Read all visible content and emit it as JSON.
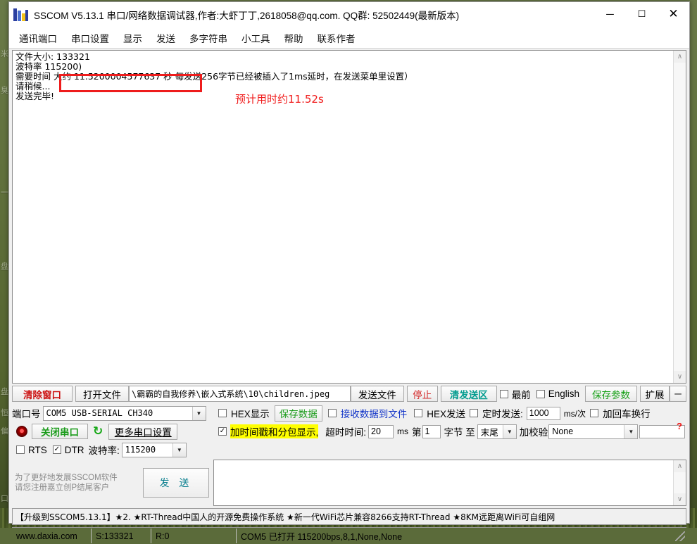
{
  "window": {
    "title": "SSCOM V5.13.1 串口/网络数据调试器,作者:大虾丁丁,2618058@qq.com. QQ群: 52502449(最新版本)",
    "app_icon": "sscom-icon",
    "minimize": "─",
    "maximize": "☐",
    "close": "✕"
  },
  "menu": {
    "items": [
      {
        "label": "通讯端口"
      },
      {
        "label": "串口设置"
      },
      {
        "label": "显示"
      },
      {
        "label": "发送"
      },
      {
        "label": "多字符串"
      },
      {
        "label": "小工具"
      },
      {
        "label": "帮助"
      },
      {
        "label": "联系作者"
      }
    ]
  },
  "receive": {
    "lines": [
      "文件大小: 133321",
      "波特率  115200)",
      "需要时间 大约 11.5200004577637 秒   每发送256字节已经被插入了1ms延时，在发送菜单里设置）",
      "请稍候...",
      "发送完毕!"
    ],
    "annotation": "预计用时约11.52s",
    "annotation_color": "#f01c1c",
    "highlight_box_color": "#ee1c1c",
    "scroll_up": "∧",
    "scroll_down": "∨"
  },
  "toolbar": {
    "clear_window": "清除窗口",
    "open_file": "打开文件",
    "file_path": "\\霸霸的自我修养\\嵌入式系统\\10\\children.jpeg",
    "send_file": "发送文件",
    "stop": "停止",
    "clear_send": "清发送区",
    "topmost_label": "最前",
    "topmost_checked": false,
    "english_label": "English",
    "english_checked": false,
    "save_params": "保存参数",
    "expand": "扩展",
    "collapse": "─"
  },
  "port_panel": {
    "port_label": "端口号",
    "port_value": "COM5 USB-SERIAL CH340",
    "close_port_button": "关闭串口",
    "refresh_icon": "refresh-icon",
    "more_settings": "更多串口设置",
    "rts_label": "RTS",
    "rts_checked": false,
    "dtr_label": "DTR",
    "dtr_checked": true,
    "baud_label": "波特率:",
    "baud_value": "115200",
    "register_line1": "为了更好地发展SSCOM软件",
    "register_line2": "请您注册嘉立创P结尾客户",
    "send_button": "发 送"
  },
  "options": {
    "hex_display_label": "HEX显示",
    "hex_display_checked": false,
    "save_data_button": "保存数据",
    "recv_to_file_label": "接收数据到文件",
    "recv_to_file_checked": false,
    "hex_send_label": "HEX发送",
    "hex_send_checked": false,
    "timed_send_label": "定时发送:",
    "timed_send_checked": false,
    "timed_send_value": "1000",
    "timed_send_unit": "ms/次",
    "crlf_label": "加回车换行",
    "crlf_checked": false,
    "timestamp_label": "加时间戳和分包显示,",
    "timestamp_checked": true,
    "timeout_label": "超时时间:",
    "timeout_value": "20",
    "timeout_unit": "ms",
    "byte_from_label": "第",
    "byte_from_value": "1",
    "byte_mid_label": "字节 至",
    "byte_to_value": "末尾",
    "checksum_label": "加校验",
    "checksum_value": "None",
    "help_marker": "?"
  },
  "ad_bar": {
    "text": "【升级到SSCOM5.13.1】★2.  ★RT-Thread中国人的开源免费操作系统 ★新一代WiFi芯片兼容8266支持RT-Thread ★8KM远距离WiFi可自组网"
  },
  "status_bar": {
    "site": "www.daxia.com",
    "sent": "S:133321",
    "received": "R:0",
    "connection": "COM5 已打开  115200bps,8,1,None,None"
  },
  "desktop": {
    "ghost_labels": [
      "米",
      "臭",
      "一",
      "盘",
      "盘",
      "恒",
      "偏",
      "口"
    ]
  }
}
